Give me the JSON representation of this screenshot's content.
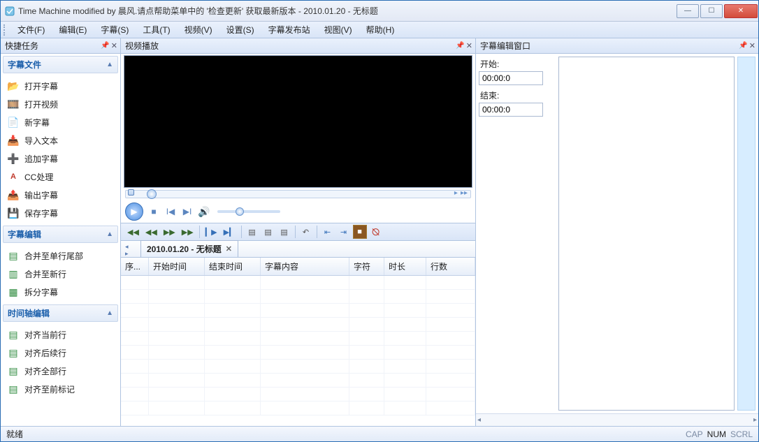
{
  "window": {
    "title": "Time Machine modified by 晨风.请点帮助菜单中的 '检查更新' 获取最新版本 - 2010.01.20 - 无标题"
  },
  "menu": {
    "file": "文件(F)",
    "edit": "编辑(E)",
    "subtitle": "字幕(S)",
    "tools": "工具(T)",
    "video": "视频(V)",
    "settings": "设置(S)",
    "publish": "字幕发布站",
    "view": "视图(V)",
    "help": "帮助(H)"
  },
  "panels": {
    "quick": "快捷任务",
    "player": "视频播放",
    "editor": "字幕编辑窗口"
  },
  "sections": {
    "s1": "字幕文件",
    "s2": "字幕编辑",
    "s3": "时间轴编辑"
  },
  "tasks": {
    "open_sub": "打开字幕",
    "open_video": "打开视频",
    "new_sub": "新字幕",
    "import_text": "导入文本",
    "append_sub": "追加字幕",
    "cc": "CC处理",
    "export_sub": "输出字幕",
    "save_sub": "保存字幕",
    "merge_tail": "合并至单行尾部",
    "merge_newline": "合并至新行",
    "split": "拆分字幕",
    "align_current": "对齐当前行",
    "align_after": "对齐后续行",
    "align_all": "对齐全部行",
    "align_marker": "对齐至前标记"
  },
  "editor": {
    "start_label": "开始:",
    "end_label": "结束:",
    "start_val": "00:00:0",
    "end_val": "00:00:0"
  },
  "tab": {
    "label": "2010.01.20 - 无标题"
  },
  "grid": {
    "c1": "序...",
    "c2": "开始时间",
    "c3": "结束时间",
    "c4": "字幕内容",
    "c5": "字符",
    "c6": "时长",
    "c7": "行数"
  },
  "status": {
    "ready": "就绪",
    "cap": "CAP",
    "num": "NUM",
    "scrl": "SCRL"
  }
}
